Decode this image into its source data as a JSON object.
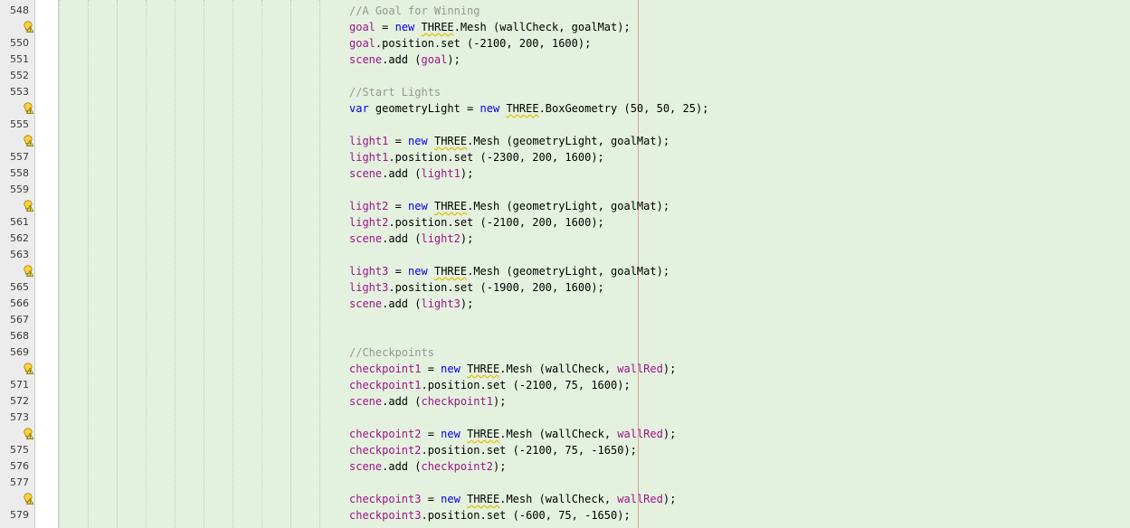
{
  "editor": {
    "colors": {
      "background": "#e4f1df",
      "keyword": "#0000e6",
      "variable": "#9c1587",
      "comment": "#969696",
      "plain": "#000000",
      "warning_underline": "#e0c000",
      "margin_line": "#e2a09a"
    },
    "gutter_icon": "warning-hint-icon",
    "lines": [
      {
        "num": "548",
        "hint": false,
        "tokens": [
          [
            "cmt",
            "//A Goal for Winning"
          ]
        ]
      },
      {
        "num": "",
        "hint": true,
        "tokens": [
          [
            "var",
            "goal"
          ],
          [
            "p",
            " = "
          ],
          [
            "kw",
            "new"
          ],
          [
            "p",
            " "
          ],
          [
            "warn",
            "THREE"
          ],
          [
            "p",
            ".Mesh (wallCheck, goalMat);"
          ]
        ]
      },
      {
        "num": "550",
        "hint": false,
        "tokens": [
          [
            "var",
            "goal"
          ],
          [
            "p",
            ".position.set (-2100, 200, 1600);"
          ]
        ]
      },
      {
        "num": "551",
        "hint": false,
        "tokens": [
          [
            "var",
            "scene"
          ],
          [
            "p",
            ".add ("
          ],
          [
            "var",
            "goal"
          ],
          [
            "p",
            ");"
          ]
        ]
      },
      {
        "num": "552",
        "hint": false,
        "tokens": []
      },
      {
        "num": "553",
        "hint": false,
        "tokens": [
          [
            "cmt",
            "//Start Lights"
          ]
        ]
      },
      {
        "num": "",
        "hint": true,
        "tokens": [
          [
            "kw",
            "var"
          ],
          [
            "p",
            " geometryLight = "
          ],
          [
            "kw",
            "new"
          ],
          [
            "p",
            " "
          ],
          [
            "warn",
            "THREE"
          ],
          [
            "p",
            ".BoxGeometry (50, 50, 25);"
          ]
        ]
      },
      {
        "num": "555",
        "hint": false,
        "tokens": []
      },
      {
        "num": "",
        "hint": true,
        "tokens": [
          [
            "var",
            "light1"
          ],
          [
            "p",
            " = "
          ],
          [
            "kw",
            "new"
          ],
          [
            "p",
            " "
          ],
          [
            "warn",
            "THREE"
          ],
          [
            "p",
            ".Mesh (geometryLight, goalMat);"
          ]
        ]
      },
      {
        "num": "557",
        "hint": false,
        "tokens": [
          [
            "var",
            "light1"
          ],
          [
            "p",
            ".position.set (-2300, 200, 1600);"
          ]
        ]
      },
      {
        "num": "558",
        "hint": false,
        "tokens": [
          [
            "var",
            "scene"
          ],
          [
            "p",
            ".add ("
          ],
          [
            "var",
            "light1"
          ],
          [
            "p",
            ");"
          ]
        ]
      },
      {
        "num": "559",
        "hint": false,
        "tokens": []
      },
      {
        "num": "",
        "hint": true,
        "tokens": [
          [
            "var",
            "light2"
          ],
          [
            "p",
            " = "
          ],
          [
            "kw",
            "new"
          ],
          [
            "p",
            " "
          ],
          [
            "warn",
            "THREE"
          ],
          [
            "p",
            ".Mesh (geometryLight, goalMat);"
          ]
        ]
      },
      {
        "num": "561",
        "hint": false,
        "tokens": [
          [
            "var",
            "light2"
          ],
          [
            "p",
            ".position.set (-2100, 200, 1600);"
          ]
        ]
      },
      {
        "num": "562",
        "hint": false,
        "tokens": [
          [
            "var",
            "scene"
          ],
          [
            "p",
            ".add ("
          ],
          [
            "var",
            "light2"
          ],
          [
            "p",
            ");"
          ]
        ]
      },
      {
        "num": "563",
        "hint": false,
        "tokens": []
      },
      {
        "num": "",
        "hint": true,
        "tokens": [
          [
            "var",
            "light3"
          ],
          [
            "p",
            " = "
          ],
          [
            "kw",
            "new"
          ],
          [
            "p",
            " "
          ],
          [
            "warn",
            "THREE"
          ],
          [
            "p",
            ".Mesh (geometryLight, goalMat);"
          ]
        ]
      },
      {
        "num": "565",
        "hint": false,
        "tokens": [
          [
            "var",
            "light3"
          ],
          [
            "p",
            ".position.set (-1900, 200, 1600);"
          ]
        ]
      },
      {
        "num": "566",
        "hint": false,
        "tokens": [
          [
            "var",
            "scene"
          ],
          [
            "p",
            ".add ("
          ],
          [
            "var",
            "light3"
          ],
          [
            "p",
            ");"
          ]
        ]
      },
      {
        "num": "567",
        "hint": false,
        "tokens": []
      },
      {
        "num": "568",
        "hint": false,
        "tokens": []
      },
      {
        "num": "569",
        "hint": false,
        "tokens": [
          [
            "cmt",
            "//Checkpoints"
          ]
        ]
      },
      {
        "num": "",
        "hint": true,
        "tokens": [
          [
            "var",
            "checkpoint1"
          ],
          [
            "p",
            " = "
          ],
          [
            "kw",
            "new"
          ],
          [
            "p",
            " "
          ],
          [
            "warn",
            "THREE"
          ],
          [
            "p",
            ".Mesh (wallCheck, "
          ],
          [
            "var",
            "wallRed"
          ],
          [
            "p",
            ");"
          ]
        ]
      },
      {
        "num": "571",
        "hint": false,
        "tokens": [
          [
            "var",
            "checkpoint1"
          ],
          [
            "p",
            ".position.set (-2100, 75, 1600);"
          ]
        ]
      },
      {
        "num": "572",
        "hint": false,
        "tokens": [
          [
            "var",
            "scene"
          ],
          [
            "p",
            ".add ("
          ],
          [
            "var",
            "checkpoint1"
          ],
          [
            "p",
            ");"
          ]
        ]
      },
      {
        "num": "573",
        "hint": false,
        "tokens": []
      },
      {
        "num": "",
        "hint": true,
        "tokens": [
          [
            "var",
            "checkpoint2"
          ],
          [
            "p",
            " = "
          ],
          [
            "kw",
            "new"
          ],
          [
            "p",
            " "
          ],
          [
            "warn",
            "THREE"
          ],
          [
            "p",
            ".Mesh (wallCheck, "
          ],
          [
            "var",
            "wallRed"
          ],
          [
            "p",
            ");"
          ]
        ]
      },
      {
        "num": "575",
        "hint": false,
        "tokens": [
          [
            "var",
            "checkpoint2"
          ],
          [
            "p",
            ".position.set (-2100, 75, -1650);"
          ]
        ]
      },
      {
        "num": "576",
        "hint": false,
        "tokens": [
          [
            "var",
            "scene"
          ],
          [
            "p",
            ".add ("
          ],
          [
            "var",
            "checkpoint2"
          ],
          [
            "p",
            ");"
          ]
        ]
      },
      {
        "num": "577",
        "hint": false,
        "tokens": []
      },
      {
        "num": "",
        "hint": true,
        "tokens": [
          [
            "var",
            "checkpoint3"
          ],
          [
            "p",
            " = "
          ],
          [
            "kw",
            "new"
          ],
          [
            "p",
            " "
          ],
          [
            "warn",
            "THREE"
          ],
          [
            "p",
            ".Mesh (wallCheck, "
          ],
          [
            "var",
            "wallRed"
          ],
          [
            "p",
            ");"
          ]
        ]
      },
      {
        "num": "579",
        "hint": false,
        "tokens": [
          [
            "var",
            "checkpoint3"
          ],
          [
            "p",
            ".position.set (-600, 75, -1650);"
          ]
        ]
      }
    ]
  }
}
